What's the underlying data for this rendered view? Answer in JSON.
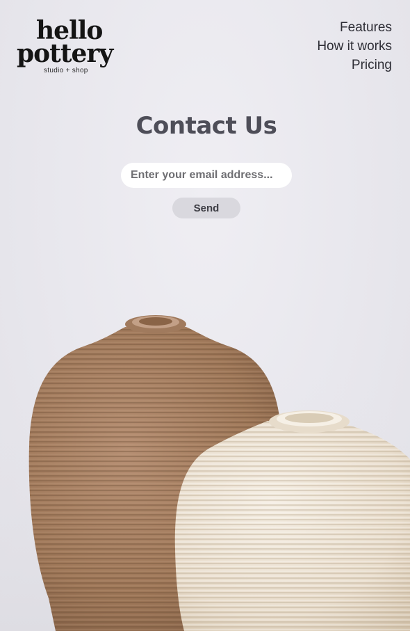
{
  "logo": {
    "line1": "hello",
    "line2": "pottery",
    "tagline": "studio + shop"
  },
  "nav": {
    "items": [
      {
        "label": "Features"
      },
      {
        "label": "How it works"
      },
      {
        "label": "Pricing"
      }
    ]
  },
  "contact": {
    "title": "Contact Us",
    "email_placeholder": "Enter your email address...",
    "email_value": "",
    "send_label": "Send"
  },
  "colors": {
    "background": "#e9e8ee",
    "title": "#4e4e58",
    "button_bg": "#d9d8de",
    "vase_brown": "#a57f64",
    "vase_cream": "#ece3d3"
  }
}
